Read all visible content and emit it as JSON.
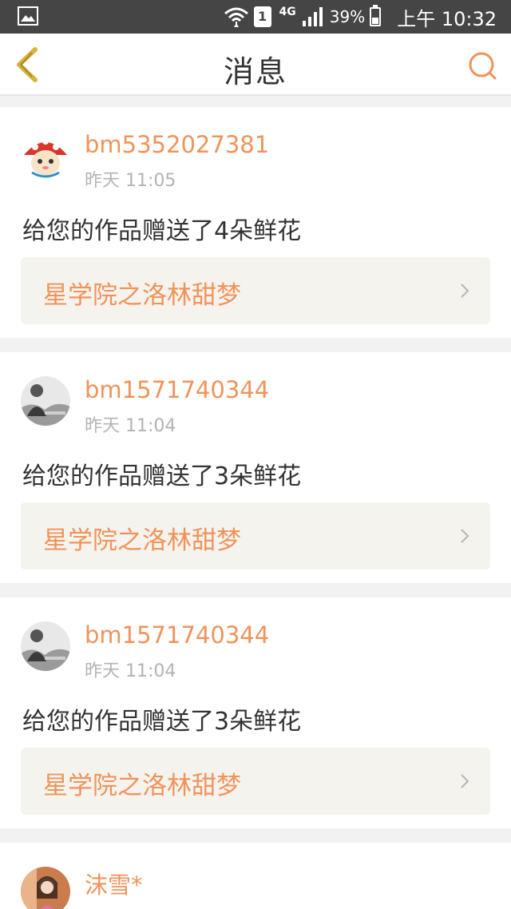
{
  "status_bar": {
    "network": "4G",
    "sim_slot": "1",
    "battery": "39%",
    "time": "上午 10:32"
  },
  "header": {
    "title": "消息"
  },
  "messages": [
    {
      "username": "bm5352027381",
      "time": "昨天 11:05",
      "text": "给您的作品赠送了4朵鲜花",
      "work_title": "星学院之洛林甜梦",
      "avatar": "mushroom-hat-cartoon-avatar"
    },
    {
      "username": "bm1571740344",
      "time": "昨天 11:04",
      "text": "给您的作品赠送了3朵鲜花",
      "work_title": "星学院之洛林甜梦",
      "avatar": "grayscale-photo-avatar"
    },
    {
      "username": "bm1571740344",
      "time": "昨天 11:04",
      "text": "给您的作品赠送了3朵鲜花",
      "work_title": "星学院之洛林甜梦",
      "avatar": "grayscale-photo-avatar"
    },
    {
      "username": "沫雪*",
      "avatar": "pink-girl-avatar"
    }
  ],
  "colors": {
    "accent": "#f0935a",
    "status_bar": "#454545",
    "card_link_bg": "#f5f3ee",
    "timestamp": "#b3b3b3"
  }
}
